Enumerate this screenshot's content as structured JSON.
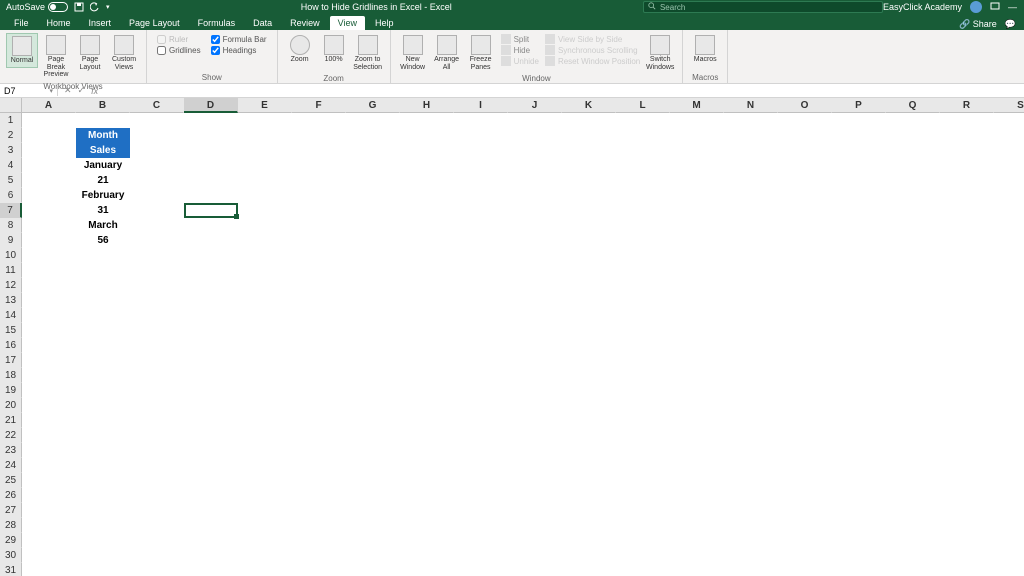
{
  "titlebar": {
    "autosave_label": "AutoSave",
    "doc_title": "How to Hide Gridlines in Excel  -  Excel",
    "search_placeholder": "Search",
    "account": "EasyClick Academy"
  },
  "tabs": [
    "File",
    "Home",
    "Insert",
    "Page Layout",
    "Formulas",
    "Data",
    "Review",
    "View",
    "Help"
  ],
  "tabs_right": {
    "share": "Share"
  },
  "ribbon": {
    "workbook_views": {
      "label": "Workbook Views",
      "normal": "Normal",
      "page_break": "Page Break Preview",
      "page_layout": "Page Layout",
      "custom": "Custom Views"
    },
    "show": {
      "label": "Show",
      "ruler": "Ruler",
      "formula_bar": "Formula Bar",
      "gridlines": "Gridlines",
      "headings": "Headings"
    },
    "zoom": {
      "label": "Zoom",
      "zoom": "Zoom",
      "hundred": "100%",
      "selection": "Zoom to Selection"
    },
    "window": {
      "label": "Window",
      "new": "New Window",
      "arrange": "Arrange All",
      "freeze": "Freeze Panes",
      "split": "Split",
      "hide": "Hide",
      "unhide": "Unhide",
      "side": "View Side by Side",
      "sync": "Synchronous Scrolling",
      "reset": "Reset Window Position",
      "switch": "Switch Windows"
    },
    "macros": {
      "label": "Macros",
      "macros": "Macros"
    }
  },
  "namebox": "D7",
  "columns": [
    "A",
    "B",
    "C",
    "D",
    "E",
    "F",
    "G",
    "H",
    "I",
    "J",
    "K",
    "L",
    "M",
    "N",
    "O",
    "P",
    "Q",
    "R",
    "S"
  ],
  "rows": 31,
  "selected": {
    "col": "D",
    "row": 7,
    "col_idx": 3,
    "row_idx": 6
  },
  "table": {
    "at": {
      "col": 1,
      "row": 1
    },
    "headers": [
      "Month",
      "Sales"
    ],
    "data": [
      [
        "January",
        21
      ],
      [
        "February",
        31
      ],
      [
        "March",
        56
      ]
    ]
  }
}
